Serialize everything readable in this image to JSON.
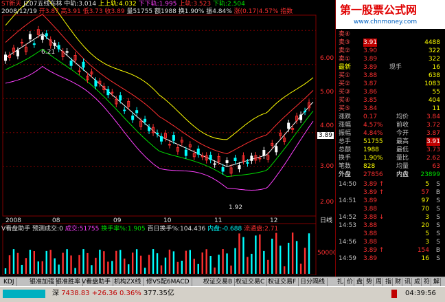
{
  "header": {
    "stock": "ST新天",
    "indicator": "JZ07五线布林",
    "mid": "中轨:3.014",
    "upper1": "上上轨:4.032",
    "lower2": "下下轨:1.995",
    "upper": "上轨:3.523",
    "lower": "下轨:2.504"
  },
  "header2": {
    "date": "2008/12/19",
    "open": "开3.87",
    "high": "高3.91",
    "low": "低3.73",
    "close": "收3.89",
    "volume": "量51755",
    "amount": "额1988",
    "turnover": "换1.90%",
    "amplitude": "振4.84%",
    "change": "涨(0.17)4.57%",
    "index": "指数"
  },
  "price_axis": [
    "6.00",
    "5.00",
    "4.00",
    "3.00",
    "2.00"
  ],
  "annotations": {
    "high": "6.21",
    "low": "1.92",
    "current": "3.89"
  },
  "date_axis": [
    "2008",
    "08",
    "09",
    "10",
    "11",
    "12"
  ],
  "period": "日线",
  "sub_header": {
    "name": "V看盘助手",
    "pred": "预测成交:0",
    "vol": "成交:51755",
    "turn": "换手率%:1.905",
    "hundred": "百日换手%:104.436",
    "sell": "内盘:-0.688",
    "flow": "流通盘:2.71"
  },
  "volume_axis": [
    "50000"
  ],
  "quote": {
    "sell": [
      {
        "label": "卖④",
        "price": "",
        "vol": ""
      },
      {
        "label": "卖③",
        "price": "3.91",
        "vol": "4488"
      },
      {
        "label": "卖②",
        "price": "3.90",
        "vol": "322"
      },
      {
        "label": "卖①",
        "price": "3.89",
        "vol": "322"
      }
    ],
    "latest": {
      "label": "最新",
      "price": "3.89",
      "tag": "现手",
      "vol": "16"
    },
    "buy": [
      {
        "label": "买①",
        "price": "3.88",
        "vol": "638"
      },
      {
        "label": "买②",
        "price": "3.87",
        "vol": "1083"
      },
      {
        "label": "买③",
        "price": "3.86",
        "vol": "55"
      },
      {
        "label": "买④",
        "price": "3.85",
        "vol": "404"
      },
      {
        "label": "买⑤",
        "price": "3.84",
        "vol": "11"
      }
    ],
    "stats": [
      {
        "l1": "涨跌",
        "v1": "0.17",
        "l2": "均价",
        "v2": "3.84"
      },
      {
        "l1": "涨幅",
        "v1": "4.57%",
        "l2": "前收",
        "v2": "3.72"
      },
      {
        "l1": "振幅",
        "v1": "4.84%",
        "l2": "今开",
        "v2": "3.87"
      },
      {
        "l1": "总手",
        "v1": "51755",
        "l2": "最高",
        "v2": "3.91"
      },
      {
        "l1": "总额",
        "v1": "1988",
        "l2": "最低",
        "v2": "3.73"
      },
      {
        "l1": "换手",
        "v1": "1.90%",
        "l2": "量比",
        "v2": "2.62"
      },
      {
        "l1": "笔数",
        "v1": "828",
        "l2": "均量",
        "v2": "63"
      }
    ],
    "outer": {
      "l1": "外盘",
      "v1": "27856",
      "l2": "内盘",
      "v2": "23899"
    },
    "ticks": [
      {
        "time": "14:50",
        "price": "3.89",
        "arrow": "↑",
        "vol": "5",
        "side": "S"
      },
      {
        "time": "",
        "price": "3.89",
        "arrow": "↑",
        "vol": "57",
        "side": "B"
      },
      {
        "time": "14:51",
        "price": "3.89",
        "arrow": "",
        "vol": "97",
        "side": "S"
      },
      {
        "time": "",
        "price": "3.88",
        "arrow": "",
        "vol": "70",
        "side": "S"
      },
      {
        "time": "14:52",
        "price": "3.88",
        "arrow": "↓",
        "vol": "3",
        "side": "S"
      },
      {
        "time": "14:53",
        "price": "3.88",
        "arrow": "",
        "vol": "20",
        "side": "S"
      },
      {
        "time": "",
        "price": "3.88",
        "arrow": "",
        "vol": "5",
        "side": "S"
      },
      {
        "time": "14:56",
        "price": "3.88",
        "arrow": "",
        "vol": "3",
        "side": "S"
      },
      {
        "time": "",
        "price": "3.89",
        "arrow": "↑",
        "vol": "154",
        "side": "B"
      },
      {
        "time": "14:59",
        "price": "3.89",
        "arrow": "",
        "vol": "16",
        "side": "S"
      }
    ]
  },
  "tabs": [
    "KDJ",
    "银准加强",
    "银准胜率",
    "V看盘助手",
    "机构ZX线",
    "修VS配6MACD",
    "权证交易B",
    "权证交易C",
    "权证交易F",
    "日分隔线"
  ],
  "side_tabs": [
    "扎",
    "价",
    "盘",
    "势",
    "周",
    "指",
    "财",
    "讯",
    "成",
    "符",
    "解"
  ],
  "status": {
    "market": "深",
    "index": "7438.83",
    "change": "+26.36",
    "pct": "0.36%",
    "amount": "377.35亿",
    "time": "04:39:56"
  },
  "logo": {
    "title": "第一股票公式网",
    "url": "www.chnmoney.com"
  }
}
